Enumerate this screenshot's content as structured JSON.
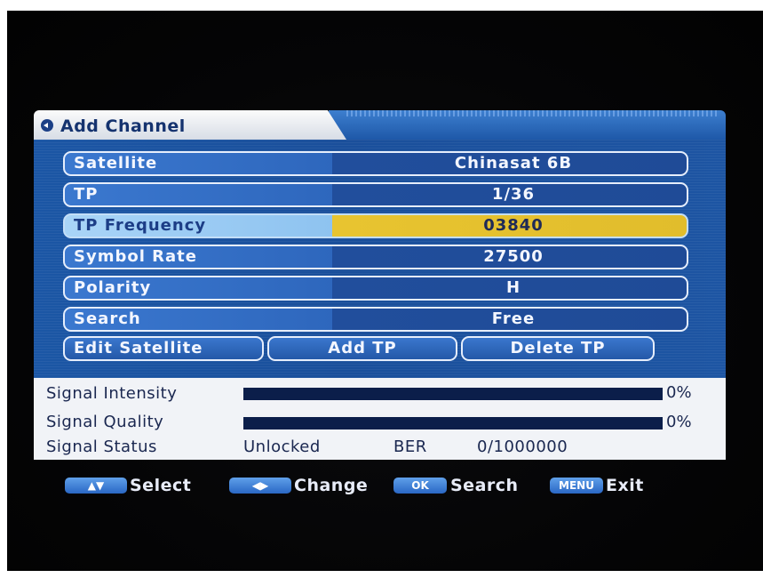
{
  "window": {
    "title": "Add Channel"
  },
  "rows": [
    {
      "label": "Satellite",
      "value": "Chinasat 6B"
    },
    {
      "label": "TP",
      "value": "1/36"
    },
    {
      "label": "TP Frequency",
      "value": "03840"
    },
    {
      "label": "Symbol Rate",
      "value": "27500"
    },
    {
      "label": "Polarity",
      "value": "H"
    },
    {
      "label": "Search",
      "value": "Free"
    }
  ],
  "buttons": {
    "edit_satellite": "Edit Satellite",
    "add_tp": "Add TP",
    "delete_tp": "Delete TP"
  },
  "signal": {
    "intensity_label": "Signal Intensity",
    "intensity_value": "0%",
    "intensity_fraction": 0,
    "quality_label": "Signal Quality",
    "quality_value": "0%",
    "quality_fraction": 0,
    "status_label": "Signal Status",
    "status_value": "Unlocked",
    "ber_label": "BER",
    "ber_value": "0/1000000"
  },
  "help": {
    "select_text": "Select",
    "change_text": "Change",
    "ok_key": "OK",
    "search_text": "Search",
    "menu_key": "MENU",
    "exit_text": "Exit"
  },
  "colors": {
    "panel_blue": "#1b56a5",
    "highlight_yellow": "#e8c430",
    "highlight_label": "#a9d4f7",
    "signal_bar": "#0b1e4a"
  }
}
